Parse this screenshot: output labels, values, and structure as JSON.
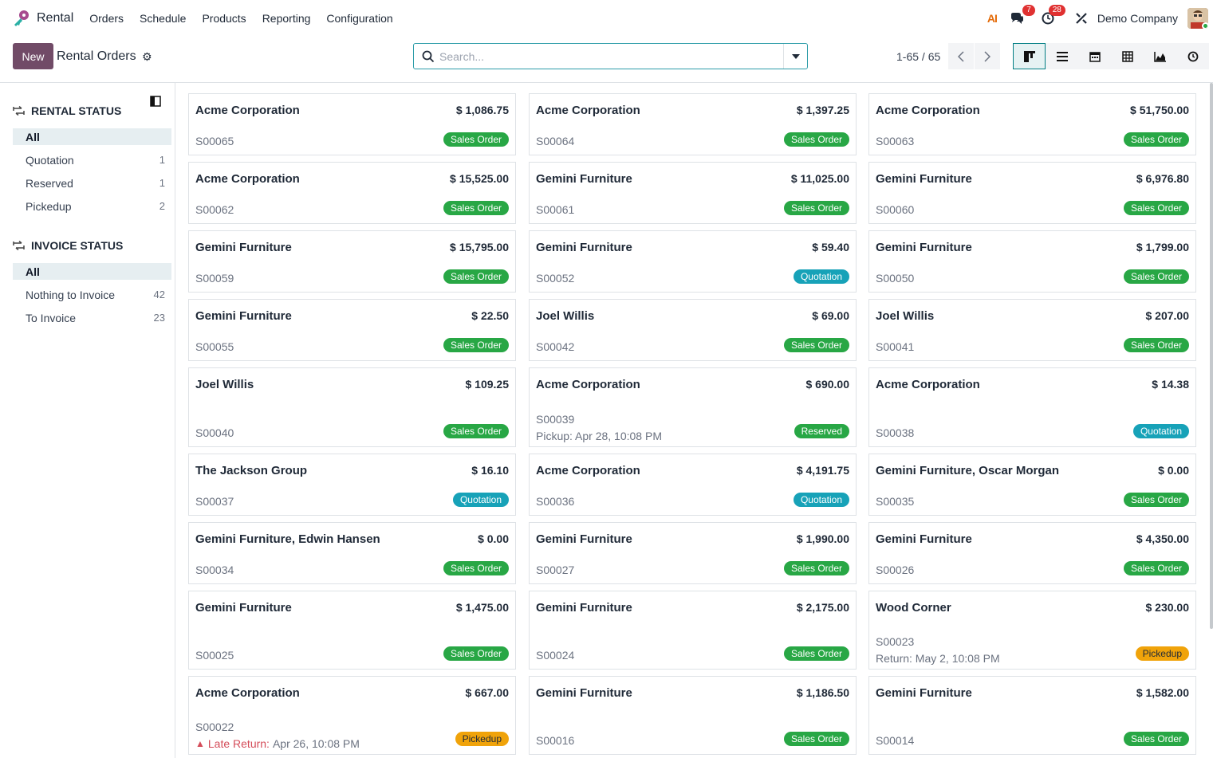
{
  "app": {
    "name": "Rental"
  },
  "menu": [
    "Orders",
    "Schedule",
    "Products",
    "Reporting",
    "Configuration"
  ],
  "topbar": {
    "ai_label": "AI",
    "messages_badge": "7",
    "activities_badge": "28",
    "company": "Demo Company"
  },
  "control": {
    "new_label": "New",
    "title": "Rental Orders",
    "search_placeholder": "Search...",
    "pager": "1-65 / 65"
  },
  "views": [
    "kanban-view-icon",
    "list-view-icon",
    "calendar-view-icon",
    "pivot-view-icon",
    "graph-view-icon",
    "activity-view-icon"
  ],
  "sidebar": {
    "rental_status": {
      "title": "RENTAL STATUS",
      "items": [
        {
          "label": "All",
          "count": ""
        },
        {
          "label": "Quotation",
          "count": "1"
        },
        {
          "label": "Reserved",
          "count": "1"
        },
        {
          "label": "Pickedup",
          "count": "2"
        }
      ]
    },
    "invoice_status": {
      "title": "INVOICE STATUS",
      "items": [
        {
          "label": "All",
          "count": ""
        },
        {
          "label": "Nothing to Invoice",
          "count": "42"
        },
        {
          "label": "To Invoice",
          "count": "23"
        }
      ]
    }
  },
  "status_colors": {
    "Sales Order": "#28a745",
    "Quotation": "#17a2b8",
    "Reserved": "#28a745",
    "Pickedup": "#f0a30a"
  },
  "cards": [
    {
      "name": "Acme Corporation",
      "amount": "$ 1,086.75",
      "ref": "S00065",
      "status": "Sales Order"
    },
    {
      "name": "Acme Corporation",
      "amount": "$ 1,397.25",
      "ref": "S00064",
      "status": "Sales Order"
    },
    {
      "name": "Acme Corporation",
      "amount": "$ 51,750.00",
      "ref": "S00063",
      "status": "Sales Order"
    },
    {
      "name": "Acme Corporation",
      "amount": "$ 15,525.00",
      "ref": "S00062",
      "status": "Sales Order"
    },
    {
      "name": "Gemini Furniture",
      "amount": "$ 11,025.00",
      "ref": "S00061",
      "status": "Sales Order"
    },
    {
      "name": "Gemini Furniture",
      "amount": "$ 6,976.80",
      "ref": "S00060",
      "status": "Sales Order"
    },
    {
      "name": "Gemini Furniture",
      "amount": "$ 15,795.00",
      "ref": "S00059",
      "status": "Sales Order"
    },
    {
      "name": "Gemini Furniture",
      "amount": "$ 59.40",
      "ref": "S00052",
      "status": "Quotation"
    },
    {
      "name": "Gemini Furniture",
      "amount": "$ 1,799.00",
      "ref": "S00050",
      "status": "Sales Order"
    },
    {
      "name": "Gemini Furniture",
      "amount": "$ 22.50",
      "ref": "S00055",
      "status": "Sales Order"
    },
    {
      "name": "Joel Willis",
      "amount": "$ 69.00",
      "ref": "S00042",
      "status": "Sales Order"
    },
    {
      "name": "Joel Willis",
      "amount": "$ 207.00",
      "ref": "S00041",
      "status": "Sales Order"
    },
    {
      "name": "Joel Willis",
      "amount": "$ 109.25",
      "ref": "S00040",
      "status": "Sales Order"
    },
    {
      "name": "Acme Corporation",
      "amount": "$ 690.00",
      "ref": "S00039",
      "status": "Reserved",
      "extra": "Pickup: Apr 28, 10:08 PM"
    },
    {
      "name": "Acme Corporation",
      "amount": "$ 14.38",
      "ref": "S00038",
      "status": "Quotation"
    },
    {
      "name": "The Jackson Group",
      "amount": "$ 16.10",
      "ref": "S00037",
      "status": "Quotation"
    },
    {
      "name": "Acme Corporation",
      "amount": "$ 4,191.75",
      "ref": "S00036",
      "status": "Quotation"
    },
    {
      "name": "Gemini Furniture, Oscar Morgan",
      "amount": "$ 0.00",
      "ref": "S00035",
      "status": "Sales Order"
    },
    {
      "name": "Gemini Furniture, Edwin Hansen",
      "amount": "$ 0.00",
      "ref": "S00034",
      "status": "Sales Order"
    },
    {
      "name": "Gemini Furniture",
      "amount": "$ 1,990.00",
      "ref": "S00027",
      "status": "Sales Order"
    },
    {
      "name": "Gemini Furniture",
      "amount": "$ 4,350.00",
      "ref": "S00026",
      "status": "Sales Order"
    },
    {
      "name": "Gemini Furniture",
      "amount": "$ 1,475.00",
      "ref": "S00025",
      "status": "Sales Order"
    },
    {
      "name": "Gemini Furniture",
      "amount": "$ 2,175.00",
      "ref": "S00024",
      "status": "Sales Order"
    },
    {
      "name": "Wood Corner",
      "amount": "$ 230.00",
      "ref": "S00023",
      "status": "Pickedup",
      "extra": "Return: May 2, 10:08 PM"
    },
    {
      "name": "Acme Corporation",
      "amount": "$ 667.00",
      "ref": "S00022",
      "status": "Pickedup",
      "late_label": "Late Return:",
      "extra": "Apr 26, 10:08 PM"
    },
    {
      "name": "Gemini Furniture",
      "amount": "$ 1,186.50",
      "ref": "S00016",
      "status": "Sales Order"
    },
    {
      "name": "Gemini Furniture",
      "amount": "$ 1,582.00",
      "ref": "S00014",
      "status": "Sales Order"
    }
  ]
}
